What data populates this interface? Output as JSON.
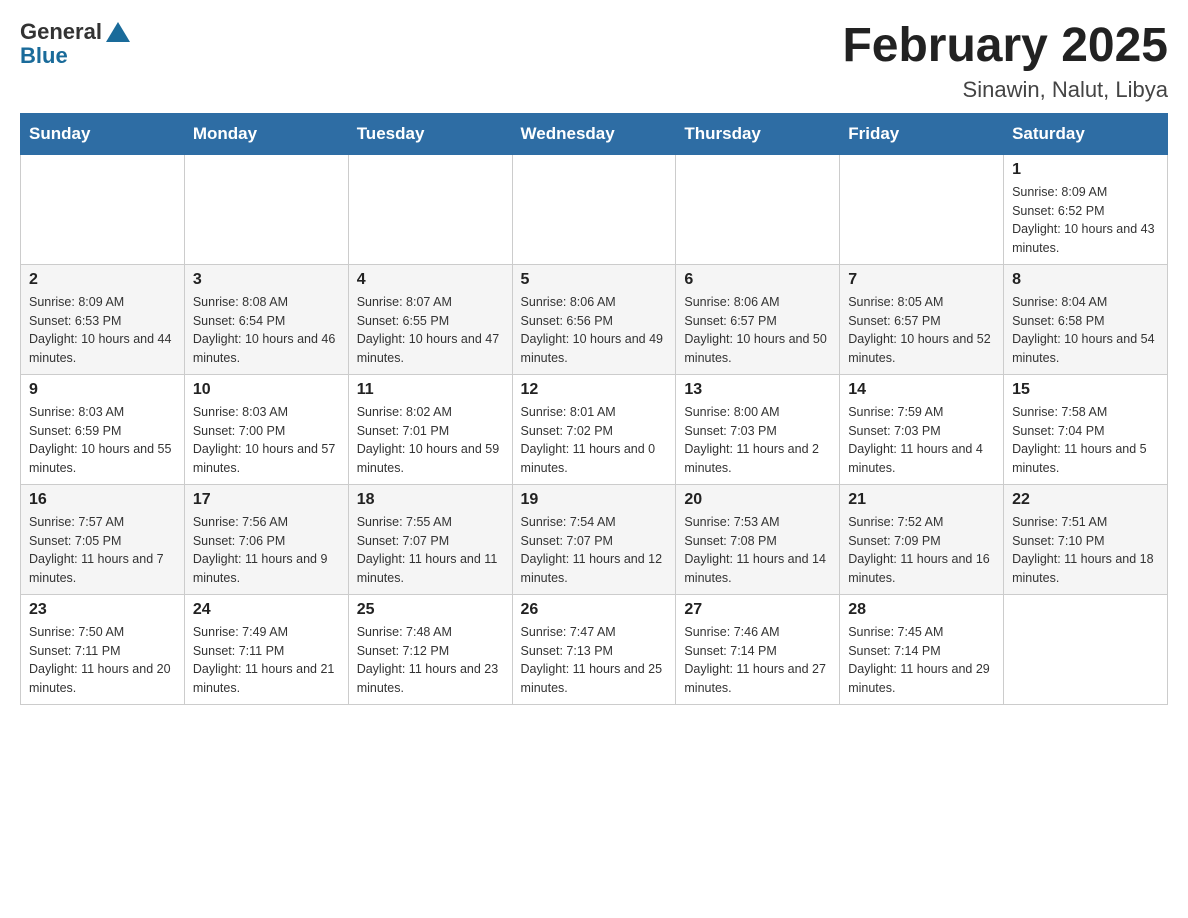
{
  "logo": {
    "text_general": "General",
    "text_blue": "Blue"
  },
  "header": {
    "month_title": "February 2025",
    "location": "Sinawin, Nalut, Libya"
  },
  "days_of_week": [
    "Sunday",
    "Monday",
    "Tuesday",
    "Wednesday",
    "Thursday",
    "Friday",
    "Saturday"
  ],
  "weeks": [
    [
      {
        "day": "",
        "sunrise": "",
        "sunset": "",
        "daylight": ""
      },
      {
        "day": "",
        "sunrise": "",
        "sunset": "",
        "daylight": ""
      },
      {
        "day": "",
        "sunrise": "",
        "sunset": "",
        "daylight": ""
      },
      {
        "day": "",
        "sunrise": "",
        "sunset": "",
        "daylight": ""
      },
      {
        "day": "",
        "sunrise": "",
        "sunset": "",
        "daylight": ""
      },
      {
        "day": "",
        "sunrise": "",
        "sunset": "",
        "daylight": ""
      },
      {
        "day": "1",
        "sunrise": "Sunrise: 8:09 AM",
        "sunset": "Sunset: 6:52 PM",
        "daylight": "Daylight: 10 hours and 43 minutes."
      }
    ],
    [
      {
        "day": "2",
        "sunrise": "Sunrise: 8:09 AM",
        "sunset": "Sunset: 6:53 PM",
        "daylight": "Daylight: 10 hours and 44 minutes."
      },
      {
        "day": "3",
        "sunrise": "Sunrise: 8:08 AM",
        "sunset": "Sunset: 6:54 PM",
        "daylight": "Daylight: 10 hours and 46 minutes."
      },
      {
        "day": "4",
        "sunrise": "Sunrise: 8:07 AM",
        "sunset": "Sunset: 6:55 PM",
        "daylight": "Daylight: 10 hours and 47 minutes."
      },
      {
        "day": "5",
        "sunrise": "Sunrise: 8:06 AM",
        "sunset": "Sunset: 6:56 PM",
        "daylight": "Daylight: 10 hours and 49 minutes."
      },
      {
        "day": "6",
        "sunrise": "Sunrise: 8:06 AM",
        "sunset": "Sunset: 6:57 PM",
        "daylight": "Daylight: 10 hours and 50 minutes."
      },
      {
        "day": "7",
        "sunrise": "Sunrise: 8:05 AM",
        "sunset": "Sunset: 6:57 PM",
        "daylight": "Daylight: 10 hours and 52 minutes."
      },
      {
        "day": "8",
        "sunrise": "Sunrise: 8:04 AM",
        "sunset": "Sunset: 6:58 PM",
        "daylight": "Daylight: 10 hours and 54 minutes."
      }
    ],
    [
      {
        "day": "9",
        "sunrise": "Sunrise: 8:03 AM",
        "sunset": "Sunset: 6:59 PM",
        "daylight": "Daylight: 10 hours and 55 minutes."
      },
      {
        "day": "10",
        "sunrise": "Sunrise: 8:03 AM",
        "sunset": "Sunset: 7:00 PM",
        "daylight": "Daylight: 10 hours and 57 minutes."
      },
      {
        "day": "11",
        "sunrise": "Sunrise: 8:02 AM",
        "sunset": "Sunset: 7:01 PM",
        "daylight": "Daylight: 10 hours and 59 minutes."
      },
      {
        "day": "12",
        "sunrise": "Sunrise: 8:01 AM",
        "sunset": "Sunset: 7:02 PM",
        "daylight": "Daylight: 11 hours and 0 minutes."
      },
      {
        "day": "13",
        "sunrise": "Sunrise: 8:00 AM",
        "sunset": "Sunset: 7:03 PM",
        "daylight": "Daylight: 11 hours and 2 minutes."
      },
      {
        "day": "14",
        "sunrise": "Sunrise: 7:59 AM",
        "sunset": "Sunset: 7:03 PM",
        "daylight": "Daylight: 11 hours and 4 minutes."
      },
      {
        "day": "15",
        "sunrise": "Sunrise: 7:58 AM",
        "sunset": "Sunset: 7:04 PM",
        "daylight": "Daylight: 11 hours and 5 minutes."
      }
    ],
    [
      {
        "day": "16",
        "sunrise": "Sunrise: 7:57 AM",
        "sunset": "Sunset: 7:05 PM",
        "daylight": "Daylight: 11 hours and 7 minutes."
      },
      {
        "day": "17",
        "sunrise": "Sunrise: 7:56 AM",
        "sunset": "Sunset: 7:06 PM",
        "daylight": "Daylight: 11 hours and 9 minutes."
      },
      {
        "day": "18",
        "sunrise": "Sunrise: 7:55 AM",
        "sunset": "Sunset: 7:07 PM",
        "daylight": "Daylight: 11 hours and 11 minutes."
      },
      {
        "day": "19",
        "sunrise": "Sunrise: 7:54 AM",
        "sunset": "Sunset: 7:07 PM",
        "daylight": "Daylight: 11 hours and 12 minutes."
      },
      {
        "day": "20",
        "sunrise": "Sunrise: 7:53 AM",
        "sunset": "Sunset: 7:08 PM",
        "daylight": "Daylight: 11 hours and 14 minutes."
      },
      {
        "day": "21",
        "sunrise": "Sunrise: 7:52 AM",
        "sunset": "Sunset: 7:09 PM",
        "daylight": "Daylight: 11 hours and 16 minutes."
      },
      {
        "day": "22",
        "sunrise": "Sunrise: 7:51 AM",
        "sunset": "Sunset: 7:10 PM",
        "daylight": "Daylight: 11 hours and 18 minutes."
      }
    ],
    [
      {
        "day": "23",
        "sunrise": "Sunrise: 7:50 AM",
        "sunset": "Sunset: 7:11 PM",
        "daylight": "Daylight: 11 hours and 20 minutes."
      },
      {
        "day": "24",
        "sunrise": "Sunrise: 7:49 AM",
        "sunset": "Sunset: 7:11 PM",
        "daylight": "Daylight: 11 hours and 21 minutes."
      },
      {
        "day": "25",
        "sunrise": "Sunrise: 7:48 AM",
        "sunset": "Sunset: 7:12 PM",
        "daylight": "Daylight: 11 hours and 23 minutes."
      },
      {
        "day": "26",
        "sunrise": "Sunrise: 7:47 AM",
        "sunset": "Sunset: 7:13 PM",
        "daylight": "Daylight: 11 hours and 25 minutes."
      },
      {
        "day": "27",
        "sunrise": "Sunrise: 7:46 AM",
        "sunset": "Sunset: 7:14 PM",
        "daylight": "Daylight: 11 hours and 27 minutes."
      },
      {
        "day": "28",
        "sunrise": "Sunrise: 7:45 AM",
        "sunset": "Sunset: 7:14 PM",
        "daylight": "Daylight: 11 hours and 29 minutes."
      },
      {
        "day": "",
        "sunrise": "",
        "sunset": "",
        "daylight": ""
      }
    ]
  ]
}
